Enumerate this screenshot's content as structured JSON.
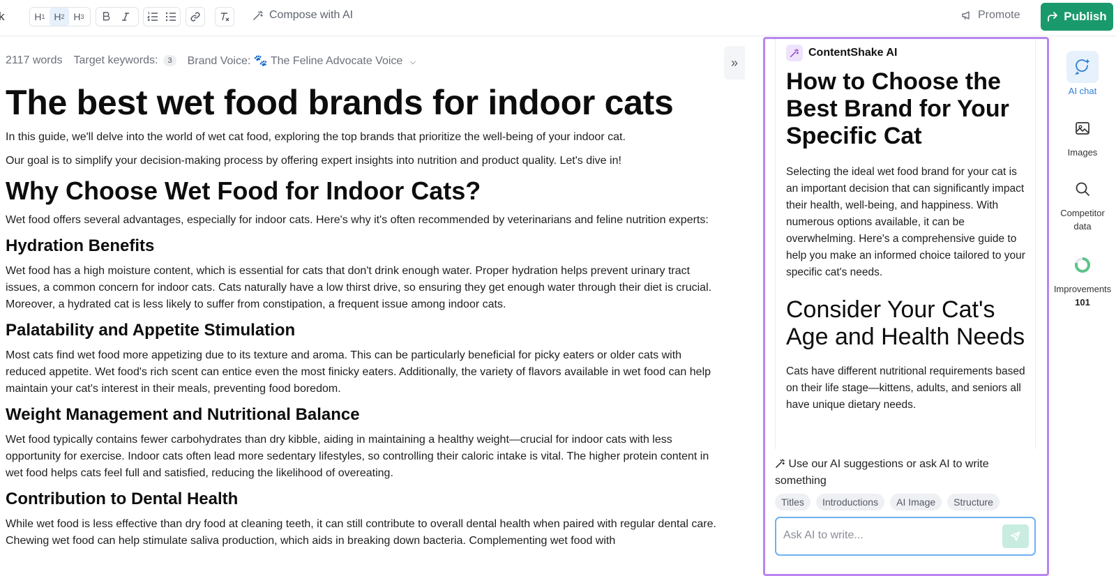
{
  "toolbar": {
    "back_fragment": "k",
    "headings": [
      {
        "letter": "H",
        "level": "1"
      },
      {
        "letter": "H",
        "level": "2"
      },
      {
        "letter": "H",
        "level": "3"
      }
    ],
    "compose_label": "Compose with AI",
    "promote_label": "Promote",
    "publish_label": "Publish",
    "colors": {
      "publish": "#1a9a6c",
      "accent": "#2f7fd6",
      "ai_border": "#b985f0"
    }
  },
  "meta": {
    "word_count": "2117 words",
    "keywords_label": "Target keywords:",
    "keywords_count": "3",
    "brand_voice": "Brand Voice: 🐾 The Feline Advocate Voice"
  },
  "article": {
    "title": "The best wet food brands for indoor cats",
    "intro_1": "In this guide, we'll delve into the world of wet cat food, exploring the top brands that prioritize the well-being of your indoor cat.",
    "intro_2": "Our goal is to simplify your decision-making process by offering expert insights into nutrition and product quality. Let's dive in!",
    "h2_why": "Why Choose Wet Food for Indoor Cats?",
    "why_text": "Wet food offers several advantages, especially for indoor cats. Here's why it's often recommended by veterinarians and feline nutrition experts:",
    "h3_hydration": "Hydration Benefits",
    "hydration_text": "Wet food has a high moisture content, which is essential for cats that don't drink enough water. Proper hydration helps prevent urinary tract issues, a common concern for indoor cats. Cats naturally have a low thirst drive, so ensuring they get enough water through their diet is crucial. Moreover, a hydrated cat is less likely to suffer from constipation, a frequent issue among indoor cats.",
    "h3_palatability": "Palatability and Appetite Stimulation",
    "palatability_text": "Most cats find wet food more appetizing due to its texture and aroma. This can be particularly beneficial for picky eaters or older cats with reduced appetite. Wet food's rich scent can entice even the most finicky eaters. Additionally, the variety of flavors available in wet food can help maintain your cat's interest in their meals, preventing food boredom.",
    "h3_weight": "Weight Management and Nutritional Balance",
    "weight_text": "Wet food typically contains fewer carbohydrates than dry kibble, aiding in maintaining a healthy weight—crucial for indoor cats with less opportunity for exercise. Indoor cats often lead more sedentary lifestyles, so controlling their caloric intake is vital. The higher protein content in wet food helps cats feel full and satisfied, reducing the likelihood of overeating.",
    "h3_dental": "Contribution to Dental Health",
    "dental_text": "While wet food is less effective than dry food at cleaning teeth, it can still contribute to overall dental health when paired with regular dental care. Chewing wet food can help stimulate saliva production, which aids in breaking down bacteria. Complementing wet food with"
  },
  "ai_panel": {
    "brand": "ContentShake AI",
    "heading_1": "How to Choose the Best Brand for Your Specific Cat",
    "para_1": "Selecting the ideal wet food brand for your cat is an important decision that can significantly impact their health, well-being, and happiness. With numerous options available, it can be overwhelming. Here's a comprehensive guide to help you make an informed choice tailored to your specific cat's needs.",
    "heading_2": "Consider Your Cat's Age and Health Needs",
    "para_2": "Cats have different nutritional requirements based on their life stage—kittens, adults, and seniors all have unique dietary needs.",
    "suggest_text": "Use our AI suggestions or ask AI to write something",
    "chips": [
      "Titles",
      "Introductions",
      "AI Image",
      "Structure"
    ],
    "input_placeholder": "Ask AI to write..."
  },
  "rail": {
    "ai_chat": "AI chat",
    "images": "Images",
    "competitor": "Competitor data",
    "improvements": "Improvements",
    "improvements_count": "101"
  }
}
